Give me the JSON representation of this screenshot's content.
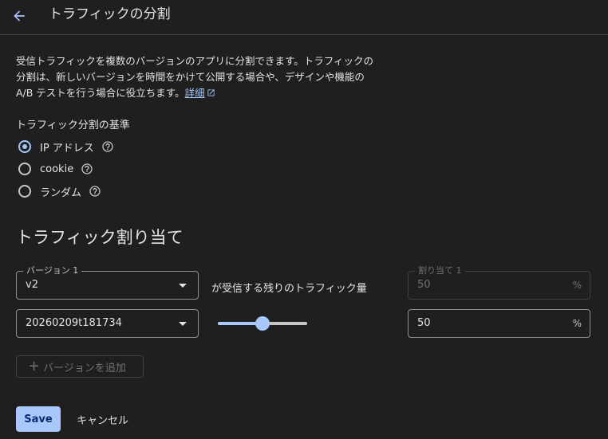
{
  "header": {
    "title": "トラフィックの分割",
    "back_icon": "arrow-back-icon"
  },
  "description": {
    "line1": "受信トラフィックを複数のバージョンのアプリに分割できます。トラフィックの",
    "line2": "分割は、新しいバージョンを時間をかけて公開する場合や、デザインや機能の",
    "line3": "A/B テストを行う場合に役立ちます。",
    "link_text": "詳細"
  },
  "split_basis": {
    "label": "トラフィック分割の基準",
    "options": [
      {
        "label": "IP アドレス",
        "checked": true
      },
      {
        "label": "cookie",
        "checked": false
      },
      {
        "label": "ランダム",
        "checked": false
      }
    ]
  },
  "allocation": {
    "title": "トラフィック割り当て",
    "version1": {
      "legend": "バージョン 1",
      "value": "v2"
    },
    "receives_remaining_text": "が受信する残りのトラフィック量",
    "allocation1": {
      "legend": "割り当て 1",
      "value": "50",
      "unit": "%"
    },
    "version2": {
      "value": "20260209t181734"
    },
    "slider_percent": 50,
    "allocation2": {
      "value": "50",
      "unit": "%"
    },
    "add_version_label": "バージョンを追加"
  },
  "actions": {
    "save_label": "Save",
    "cancel_label": "キャンセル"
  },
  "colors": {
    "accent": "#a8c7fa",
    "background": "#1f1f1f"
  }
}
